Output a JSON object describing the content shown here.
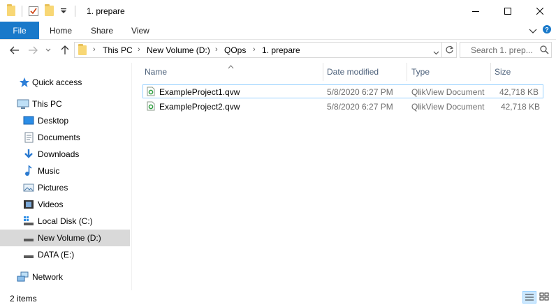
{
  "window": {
    "title": "1. prepare"
  },
  "ribbon": {
    "file": "File",
    "tabs": [
      "Home",
      "Share",
      "View"
    ]
  },
  "address": {
    "crumbs": [
      "This PC",
      "New Volume (D:)",
      "QOps",
      "1. prepare"
    ],
    "search_placeholder": "Search 1. prep..."
  },
  "nav": {
    "quick_access": "Quick access",
    "this_pc": "This PC",
    "items": [
      "Desktop",
      "Documents",
      "Downloads",
      "Music",
      "Pictures",
      "Videos",
      "Local Disk (C:)",
      "New Volume (D:)",
      "DATA (E:)"
    ],
    "network": "Network"
  },
  "columns": {
    "name": "Name",
    "date": "Date modified",
    "type": "Type",
    "size": "Size"
  },
  "files": [
    {
      "name": "ExampleProject1.qvw",
      "date": "5/8/2020 6:27 PM",
      "type": "QlikView Document",
      "size": "42,718 KB"
    },
    {
      "name": "ExampleProject2.qvw",
      "date": "5/8/2020 6:27 PM",
      "type": "QlikView Document",
      "size": "42,718 KB"
    }
  ],
  "status": {
    "count": "2 items"
  },
  "colors": {
    "accent": "#1979ca",
    "selection": "#d9d9d9",
    "focus_border": "#99d1ff",
    "header_text": "#4c607a"
  }
}
